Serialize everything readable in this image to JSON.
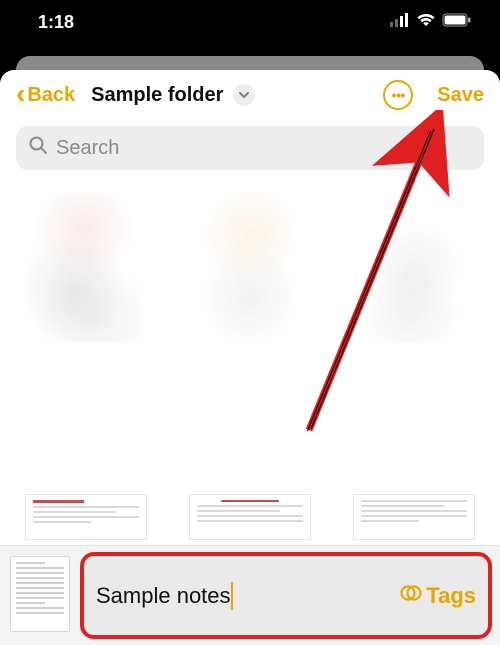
{
  "status": {
    "time": "1:18"
  },
  "nav": {
    "back_label": "Back",
    "title": "Sample folder",
    "save_label": "Save"
  },
  "search": {
    "placeholder": "Search"
  },
  "input": {
    "note_title": "Sample notes",
    "tags_label": "Tags"
  },
  "colors": {
    "accent": "#e6a800",
    "annotation": "#e02020"
  }
}
